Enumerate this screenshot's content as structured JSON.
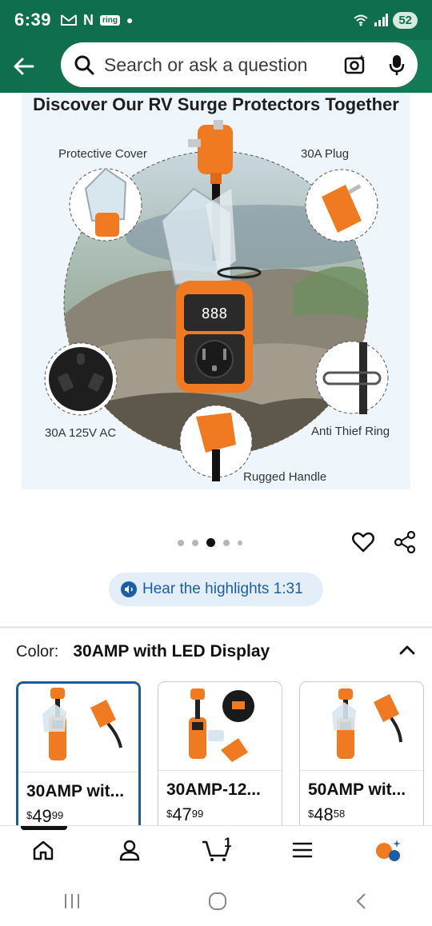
{
  "status_bar": {
    "time": "6:39",
    "notif_icons": [
      "gmail-icon",
      "netflix-icon",
      "ring-icon"
    ],
    "ring_badge": "ring",
    "battery": "52"
  },
  "search": {
    "placeholder": "Search or ask a question"
  },
  "hero": {
    "title": "Discover Our RV Surge Protectors Together",
    "labels": {
      "protective_cover": "Protective Cover",
      "plug": "30A Plug",
      "outlet": "30A 125V AC",
      "anti_thief": "Anti Thief Ring",
      "handle": "Rugged Handle"
    },
    "display_digits": "888"
  },
  "carousel": {
    "count": 5,
    "active_index": 2
  },
  "hear_highlights": {
    "label": "Hear the highlights 1:31"
  },
  "color_selector": {
    "key": "Color:",
    "value": "30AMP with LED Display",
    "options": [
      {
        "title": "30AMP wit...",
        "price_symbol": "$",
        "price_whole": "49",
        "price_fraction": "99",
        "selected": true
      },
      {
        "title": "30AMP-12...",
        "price_symbol": "$",
        "price_whole": "47",
        "price_fraction": "99",
        "selected": false
      },
      {
        "title": "50AMP wit...",
        "price_symbol": "$",
        "price_whole": "48",
        "price_fraction": "58",
        "selected": false
      }
    ]
  },
  "bottom_nav": {
    "cart_count": "1",
    "items": [
      "home-icon",
      "account-icon",
      "cart-icon",
      "menu-icon",
      "rufus-icon"
    ]
  },
  "colors": {
    "header_green": "#0f6e4d",
    "accent_orange": "#f07a22",
    "link_blue": "#1a5fa8",
    "selected_border": "#1d5a99"
  }
}
